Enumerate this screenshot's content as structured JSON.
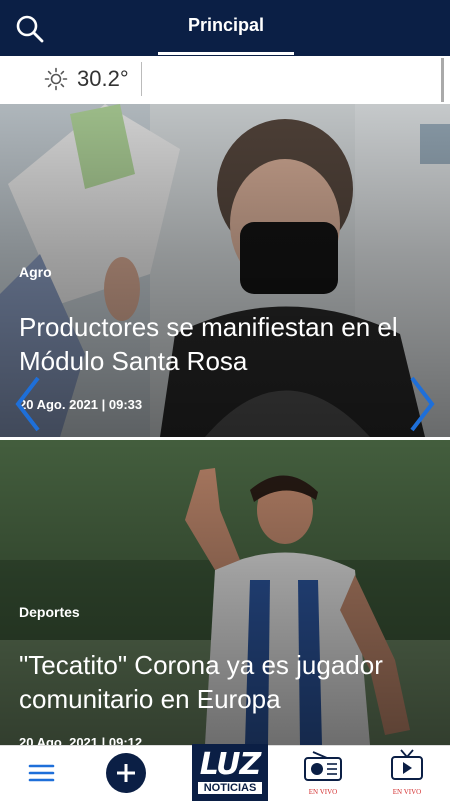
{
  "header": {
    "tab_label": "Principal"
  },
  "weather": {
    "temperature": "30.2°"
  },
  "articles": [
    {
      "category": "Agro",
      "title": "Productores se manifiestan en el Módulo Santa Rosa",
      "date": "20 Ago. 2021 | 09:33"
    },
    {
      "category": "Deportes",
      "title": "\"Tecatito\" Corona ya es jugador comunitario en Europa",
      "date": "20 Ago. 2021 | 09:12"
    }
  ],
  "bottom_nav": {
    "logo": {
      "top": "LUZ",
      "bottom": "NOTICIAS"
    },
    "radio_label": "EN VIVO",
    "tv_label": "EN VIVO"
  },
  "colors": {
    "brand_navy": "#0b1f45",
    "accent_blue": "#1e6fd9",
    "live_red": "#d32f2f"
  }
}
